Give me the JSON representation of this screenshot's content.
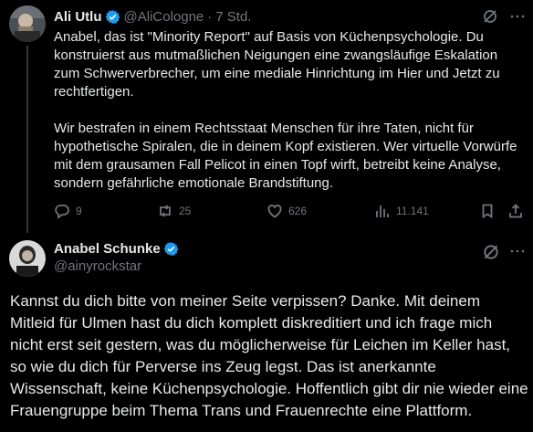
{
  "reply": {
    "author_name": "Ali Utlu",
    "author_handle": "@AliCologne",
    "separator": "·",
    "time": "7 Std.",
    "text_p1": "Anabel, das ist \"Minority Report\" auf Basis von Küchenpsychologie. Du konstruierst aus mutmaßlichen Neigungen eine zwangsläufige Eskalation zum Schwerverbrecher, um eine mediale Hinrichtung im Hier und Jetzt zu rechtfertigen.",
    "text_p2": "Wir bestrafen in einem Rechtsstaat Menschen für ihre Taten, nicht für hypothetische Spiralen, die in deinem Kopf existieren. Wer virtuelle Vorwürfe mit dem grausamen Fall Pelicot in einen Topf wirft, betreibt keine Analyse, sondern gefährliche emotionale Brandstiftung.",
    "replies": "9",
    "reposts": "25",
    "likes": "626",
    "views": "11.141"
  },
  "main": {
    "author_name": "Anabel Schunke",
    "author_handle": "@ainyrockstar",
    "text": "Kannst du dich bitte von meiner Seite verpissen? Danke. Mit deinem Mitleid für Ulmen hast du dich komplett diskreditiert und ich frage mich nicht erst seit gestern, was du möglicherweise für Leichen im Keller hast, so wie du dich für Perverse ins Zeug legst. Das ist anerkannte Wissenschaft, keine Küchenpsychologie. Hoffentlich gibt dir nie wieder eine Frauengruppe beim Thema Trans und Frauenrechte eine Plattform."
  },
  "icons": {
    "verified": "verified-badge-icon",
    "grok": "grok-icon",
    "more": "more-icon",
    "reply": "reply-icon",
    "repost": "repost-icon",
    "like": "like-icon",
    "views": "views-icon",
    "bookmark": "bookmark-icon",
    "share": "share-icon"
  },
  "colors": {
    "background": "#000000",
    "text": "#e7e9ea",
    "muted": "#71767b",
    "verified": "#1d9bf0",
    "thread_line": "#333639"
  }
}
